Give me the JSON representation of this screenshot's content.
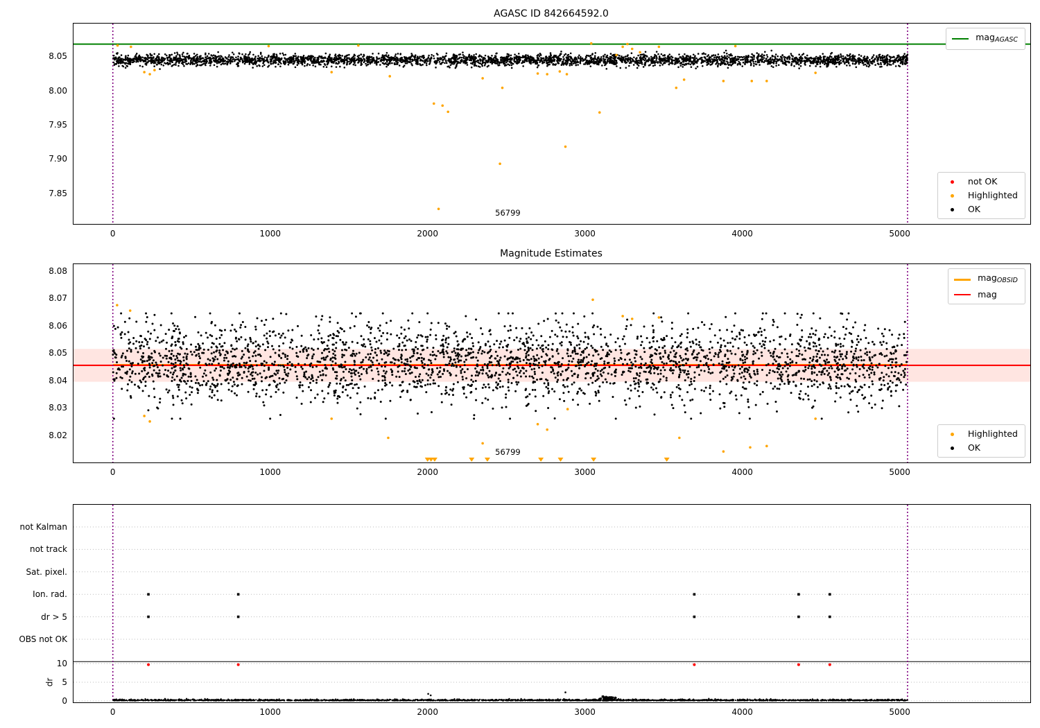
{
  "colors": {
    "ok": "#000000",
    "highlighted": "#FFA500",
    "not_ok": "#FF0000",
    "agasc_line": "#008000",
    "mag_line": "#FF0000",
    "obsid_line": "#FFA500",
    "vline": "#800080",
    "band": "rgba(255,70,40,0.14)",
    "grid": "#bbbbbb"
  },
  "chart_data": [
    {
      "id": "mag_agasc",
      "type": "scatter",
      "title": "AGASC ID 842664592.0",
      "xlim": [
        -250,
        5830
      ],
      "ylim": [
        7.805,
        8.098
      ],
      "xticks": [
        {
          "v": 0,
          "label": "0"
        },
        {
          "v": 1000,
          "label": "1000"
        },
        {
          "v": 2000,
          "label": "2000"
        },
        {
          "v": 3000,
          "label": "3000"
        },
        {
          "v": 4000,
          "label": "4000"
        },
        {
          "v": 5000,
          "label": "5000"
        }
      ],
      "yticks": [
        {
          "v": 8.05,
          "label": "8.05"
        },
        {
          "v": 8.0,
          "label": "8.00"
        },
        {
          "v": 7.95,
          "label": "7.95"
        },
        {
          "v": 7.9,
          "label": "7.90"
        },
        {
          "v": 7.85,
          "label": "7.85"
        }
      ],
      "hline_mag_agasc": 8.068,
      "vlines": [
        0,
        5050
      ],
      "annotation": {
        "text": "56799",
        "x": 2510,
        "y": 7.821
      },
      "ok_cloud": {
        "n": 3600,
        "x_min": 0,
        "x_max": 5050,
        "mean": 8.0447,
        "std": 0.0042,
        "clip_min": 8.0315,
        "clip_max": 8.0585,
        "seed": 42
      },
      "highlighted_points": [
        [
          30,
          8.066
        ],
        [
          115,
          8.064
        ],
        [
          200,
          8.027
        ],
        [
          235,
          8.024
        ],
        [
          265,
          8.03
        ],
        [
          990,
          8.065
        ],
        [
          1390,
          8.027
        ],
        [
          1560,
          8.066
        ],
        [
          1760,
          8.021
        ],
        [
          2040,
          7.981
        ],
        [
          2095,
          7.978
        ],
        [
          2130,
          7.969
        ],
        [
          2070,
          7.827
        ],
        [
          2350,
          8.018
        ],
        [
          2460,
          7.893
        ],
        [
          2475,
          8.004
        ],
        [
          2700,
          8.025
        ],
        [
          2760,
          8.024
        ],
        [
          2840,
          8.028
        ],
        [
          2885,
          8.024
        ],
        [
          2876,
          7.918
        ],
        [
          3040,
          8.069
        ],
        [
          3093,
          7.968
        ],
        [
          3200,
          8.052
        ],
        [
          3240,
          8.064
        ],
        [
          3270,
          8.068
        ],
        [
          3300,
          8.061
        ],
        [
          3350,
          8.056
        ],
        [
          3470,
          8.064
        ],
        [
          3580,
          8.004
        ],
        [
          3630,
          8.016
        ],
        [
          3880,
          8.014
        ],
        [
          3956,
          8.065
        ],
        [
          4060,
          8.014
        ],
        [
          4155,
          8.014
        ],
        [
          4465,
          8.026
        ]
      ],
      "legend_mag": [
        {
          "swatch": "line",
          "color": "#008000",
          "label": "mag",
          "sub": "AGASC"
        }
      ],
      "legend_points": [
        {
          "swatch": "dot",
          "color": "#FF0000",
          "label": "not OK"
        },
        {
          "swatch": "dot",
          "color": "#FFA500",
          "label": "Highlighted"
        },
        {
          "swatch": "dot",
          "color": "#000000",
          "label": "OK"
        }
      ]
    },
    {
      "id": "magnitude_estimates",
      "type": "scatter",
      "title": "Magnitude Estimates",
      "xlim": [
        -250,
        5830
      ],
      "ylim": [
        8.01,
        8.0825
      ],
      "xticks": [
        {
          "v": 0,
          "label": "0"
        },
        {
          "v": 1000,
          "label": "1000"
        },
        {
          "v": 2000,
          "label": "2000"
        },
        {
          "v": 3000,
          "label": "3000"
        },
        {
          "v": 4000,
          "label": "4000"
        },
        {
          "v": 5000,
          "label": "5000"
        }
      ],
      "yticks": [
        {
          "v": 8.08,
          "label": "8.08"
        },
        {
          "v": 8.07,
          "label": "8.07"
        },
        {
          "v": 8.06,
          "label": "8.06"
        },
        {
          "v": 8.05,
          "label": "8.05"
        },
        {
          "v": 8.04,
          "label": "8.04"
        },
        {
          "v": 8.03,
          "label": "8.03"
        },
        {
          "v": 8.02,
          "label": "8.02"
        }
      ],
      "mag_line": 8.0455,
      "obsid_line": {
        "y": 8.046,
        "x_min": 0,
        "x_max": 5050
      },
      "band": {
        "low": 8.0395,
        "high": 8.0515
      },
      "vlines": [
        0,
        5050
      ],
      "annotation": {
        "text": "56799",
        "x": 2510,
        "y": 8.0138
      },
      "ok_cloud": {
        "n": 3000,
        "x_min": 0,
        "x_max": 5050,
        "mean": 8.0465,
        "std": 0.0074,
        "clip_min": 8.026,
        "clip_max": 8.0645,
        "seed": 3
      },
      "highlighted_points": [
        [
          27,
          8.0675
        ],
        [
          110,
          8.0655
        ],
        [
          200,
          8.027
        ],
        [
          235,
          8.025
        ],
        [
          1390,
          8.026
        ],
        [
          1750,
          8.019
        ],
        [
          2350,
          8.017
        ],
        [
          2700,
          8.024
        ],
        [
          2760,
          8.022
        ],
        [
          2890,
          8.0295
        ],
        [
          3050,
          8.0695
        ],
        [
          3240,
          8.0635
        ],
        [
          3300,
          8.0625
        ],
        [
          3470,
          8.063
        ],
        [
          3600,
          8.019
        ],
        [
          3880,
          8.014
        ],
        [
          4050,
          8.0155
        ],
        [
          4155,
          8.016
        ],
        [
          4465,
          8.026
        ]
      ],
      "below_range_markers_x": [
        2000,
        2022,
        2045,
        2280,
        2380,
        2720,
        2845,
        3055,
        3520
      ],
      "legend_mag": [
        {
          "swatch": "line",
          "color": "#FFA500",
          "label": "mag",
          "sub": "OBSID",
          "thick": true
        },
        {
          "swatch": "line",
          "color": "#FF0000",
          "label": "mag"
        }
      ],
      "legend_points": [
        {
          "swatch": "dot",
          "color": "#FFA500",
          "label": "Highlighted"
        },
        {
          "swatch": "dot",
          "color": "#000000",
          "label": "OK"
        }
      ]
    },
    {
      "id": "flags_and_dr",
      "type": "scatter",
      "xlim": [
        -250,
        5830
      ],
      "xticks": [
        {
          "v": 0,
          "label": "0"
        },
        {
          "v": 1000,
          "label": "1000"
        },
        {
          "v": 2000,
          "label": "2000"
        },
        {
          "v": 3000,
          "label": "3000"
        },
        {
          "v": 4000,
          "label": "4000"
        },
        {
          "v": 5000,
          "label": "5000"
        }
      ],
      "flag_rows": [
        "not Kalman",
        "not track",
        "Sat. pixel.",
        "Ion. rad.",
        "dr > 5",
        "OBS not OK"
      ],
      "dr_label": "dr",
      "dr_ticks": [
        {
          "v": 10,
          "label": "10"
        },
        {
          "v": 5,
          "label": "5"
        },
        {
          "v": 0,
          "label": "0"
        }
      ],
      "separator_dr": 10.5,
      "vlines": [
        0,
        5050
      ],
      "flag_markers": {
        "Ion. rad.": [
          226,
          797,
          3695,
          4358,
          4556
        ],
        "dr > 5": [
          226,
          797,
          3695,
          4358,
          4556
        ]
      },
      "not_ok_dr_points": [
        [
          226,
          9.7
        ],
        [
          797,
          9.7
        ],
        [
          3695,
          9.7
        ],
        [
          4358,
          9.7
        ],
        [
          4556,
          9.7
        ]
      ],
      "dr_outliers": [
        [
          2004,
          1.9
        ],
        [
          2020,
          1.5
        ],
        [
          2876,
          2.3
        ]
      ],
      "dr_cloud": {
        "n": 2600,
        "x_min": 0,
        "x_max": 5050,
        "base": 0.07,
        "spread": 0.16,
        "max": 0.85,
        "seed": 7
      },
      "dr_cluster": {
        "n": 90,
        "x_mean": 3145,
        "x_std": 22,
        "y_mean": 0.6,
        "y_std": 0.28,
        "y_min": 0.12,
        "y_max": 1.25,
        "seed": 11
      }
    }
  ]
}
